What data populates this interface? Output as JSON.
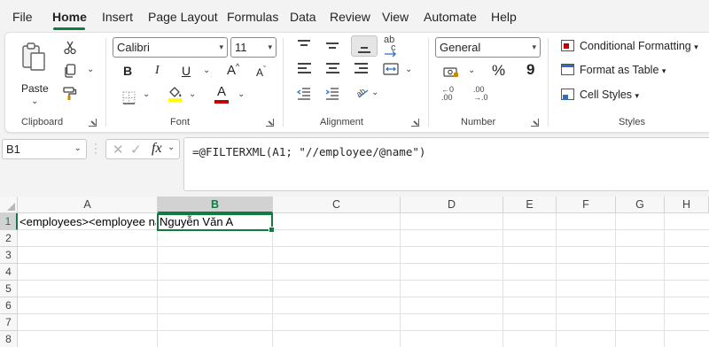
{
  "menu": {
    "tabs": [
      {
        "id": "file",
        "label": "File"
      },
      {
        "id": "home",
        "label": "Home",
        "active": true
      },
      {
        "id": "insert",
        "label": "Insert"
      },
      {
        "id": "page_layout",
        "label": "Page Layout"
      },
      {
        "id": "formulas",
        "label": "Formulas"
      },
      {
        "id": "data",
        "label": "Data"
      },
      {
        "id": "review",
        "label": "Review"
      },
      {
        "id": "view",
        "label": "View"
      },
      {
        "id": "automate",
        "label": "Automate"
      },
      {
        "id": "help",
        "label": "Help"
      }
    ]
  },
  "ribbon": {
    "clipboard": {
      "label": "Clipboard",
      "paste_label": "Paste",
      "icons": [
        "paste-icon",
        "cut-icon",
        "copy-icon",
        "format-painter-icon"
      ]
    },
    "font": {
      "label": "Font",
      "font_name": "Calibri",
      "font_size": "11",
      "bold": "B",
      "italic": "I",
      "underline": "U",
      "grow": "A",
      "shrink": "A",
      "font_color": "A",
      "highlight_color": "#ffff00",
      "text_color": "#c00000"
    },
    "alignment": {
      "label": "Alignment",
      "wrap_text_glyph": "ab",
      "wrap_text_glyph2": "c"
    },
    "number": {
      "label": "Number",
      "format": "General",
      "percent": "%",
      "comma": "9",
      "increase_decimal": ".00",
      "decrease_decimal": ".00",
      "increase_decimal_top": "←0",
      "decrease_decimal_top": "→.0"
    },
    "styles": {
      "label": "Styles",
      "conditional_formatting": "Conditional Formatting",
      "format_as_table": "Format as Table",
      "cell_styles": "Cell Styles"
    }
  },
  "formula_bar": {
    "name_box": "B1",
    "fx": "fx",
    "formula": "=@FILTERXML(A1; \"//employee/@name\")"
  },
  "grid": {
    "columns": [
      "A",
      "B",
      "C",
      "D",
      "E",
      "F",
      "G",
      "H"
    ],
    "selected_column": "B",
    "rows": [
      "1",
      "2",
      "3",
      "4",
      "5",
      "6",
      "7",
      "8"
    ],
    "cells": {
      "A1": "<employees><employee name",
      "B1": "Nguyễn Văn A"
    },
    "accent_color": "#107c41"
  }
}
